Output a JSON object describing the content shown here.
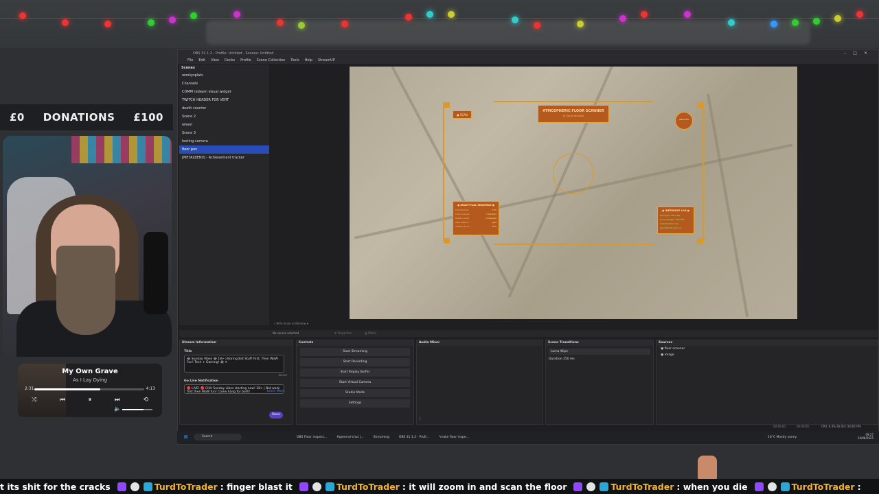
{
  "donations": {
    "left": "£0",
    "center": "DONATIONS",
    "right": "£100"
  },
  "player": {
    "title": "My Own Grave",
    "artist": "As I Lay Dying",
    "time_current": "2:31",
    "time_total": "4:13",
    "progress": 0.6
  },
  "obs": {
    "title": "OBS 31.1.2 - Profile: Untitled - Scenes: Untitled",
    "menu": [
      "File",
      "Edit",
      "View",
      "Docks",
      "Profile",
      "Scene Collection",
      "Tools",
      "Help",
      "StreamUP"
    ],
    "scenes_header": "Scenes",
    "scenes": [
      "wonkysplats",
      "Channels",
      "COMM redeem visual widget",
      "TWITCH HEADER FOR VERT",
      "death counter",
      "Scene 2",
      "wheel",
      "Scene 3",
      "testing camera",
      "floor pov",
      "[METALBEN0] - Achievement tracker"
    ],
    "active_scene_index": 9,
    "source_bar": {
      "none": "No source selected",
      "properties": "Properties",
      "filters": "Filters"
    },
    "hud": {
      "title": "ATMOSPHERIC FLOOR SCANNER",
      "subtitle": "AI Visual Analysis",
      "left_badge": "● SCAN",
      "right_badge": "ANALYSIS",
      "left_panel_title": "● ANALYTICAL READINGS ●",
      "left_panel_rows": [
        [
          "Dust Particles",
          "0.3%"
        ],
        [
          "Crack Analysis",
          "7 detected"
        ],
        [
          "Moisture Level",
          "Acceptable"
        ],
        [
          "Wear Patterns",
          "Light"
        ],
        [
          "Integrity Score",
          "82%"
        ]
      ],
      "right_panel_title": "● INFERENCE LOG ●",
      "right_panel_lines": [
        "Floor type: Stone tile",
        "Grout damage: moderate",
        "Contamination: low",
        "Age estimate: 20+ yrs"
      ]
    }
  },
  "stream_info": {
    "header": "Stream Information",
    "title_label": "Title",
    "title_value": "😂 Sunday Vibes 😂 18+ | Boring Bot Stuff First, Then WoW Fun! Tech + Gaming! 😂 ✕",
    "count": "80/140",
    "notif_label": "Go Live Notification",
    "learn_more": "Learn More",
    "notif_value": "🔴 LIVE! 🔴 Chill Sunday vibes starting now! 18+ | Bot work first then WoW fun! Come hang for both!",
    "done": "Done"
  },
  "controls": {
    "header": "Controls",
    "buttons": [
      "Start Streaming",
      "Start Recording",
      "Start Replay Buffer",
      "Start Virtual Camera",
      "Studio Mode",
      "Settings"
    ]
  },
  "audio_mixer": {
    "header": "Audio Mixer"
  },
  "scene_transitions": {
    "header": "Scene Transitions",
    "transition": "Luma Wipe",
    "duration_label": "Duration",
    "duration_value": "350 ms"
  },
  "sources": {
    "header": "Sources",
    "items": [
      "floor scanner",
      "image"
    ]
  },
  "taskbar": {
    "search": "Search",
    "apps": [
      "OBS Floor inspect...",
      "#general-chat |...",
      "Streaming",
      "OBS 31.1.2 - Profi...",
      "*make floor inspe..."
    ],
    "weather": "16°C Mostly sunny",
    "time": "09:27",
    "date": "24/08/2025",
    "stats": "CPU: 0.4%    30.00 / 30.00 FPS",
    "timer1": "00:00:00",
    "timer2": "00:00:00"
  },
  "ticker": {
    "m0": "t its shit for the cracks",
    "u1": "TurdToTrader",
    "m1": ":  finger blast it",
    "u2": "TurdToTrader",
    "m2": ":  it will zoom in and scan the floor",
    "u3": "TurdToTrader",
    "m3": ":  when you die",
    "u4": "TurdToTrader",
    "m4": ":"
  }
}
